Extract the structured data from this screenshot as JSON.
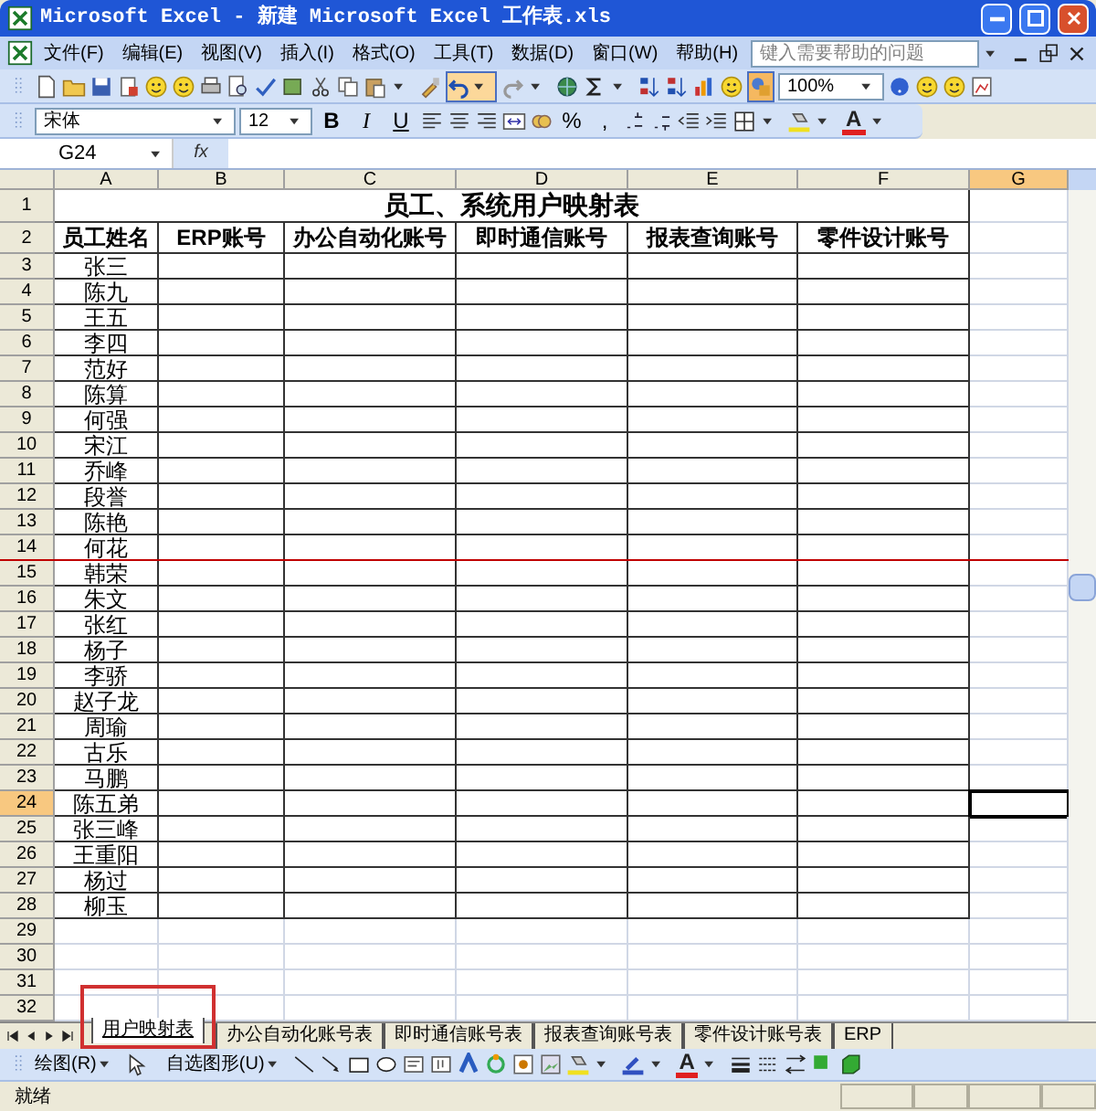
{
  "window": {
    "title": "Microsoft Excel - 新建 Microsoft Excel 工作表.xls"
  },
  "menu": [
    "文件(F)",
    "编辑(E)",
    "视图(V)",
    "插入(I)",
    "格式(O)",
    "工具(T)",
    "数据(D)",
    "窗口(W)",
    "帮助(H)"
  ],
  "help_box": {
    "placeholder": "键入需要帮助的问题"
  },
  "standard_toolbar": {
    "zoom": "100%"
  },
  "format_toolbar": {
    "font": "宋体",
    "size": "12",
    "style_buttons": [
      "B",
      "I",
      "U"
    ],
    "number_buttons": [
      "%",
      ","
    ],
    "font_color": "A"
  },
  "formula_bar": {
    "name_box": "G24",
    "fx": "fx"
  },
  "sheet": {
    "columns": [
      {
        "label": "A",
        "selected": false
      },
      {
        "label": "B",
        "selected": false
      },
      {
        "label": "C",
        "selected": false
      },
      {
        "label": "D",
        "selected": false
      },
      {
        "label": "E",
        "selected": false
      },
      {
        "label": "F",
        "selected": false
      },
      {
        "label": "G",
        "selected": true
      }
    ],
    "rows": [
      {
        "number": "1",
        "selected": false,
        "title": "员工、系统用户映射表"
      },
      {
        "number": "2",
        "selected": false,
        "cells": [
          "员工姓名",
          "ERP账号",
          "办公自动化账号",
          "即时通信账号",
          "报表查询账号",
          "零件设计账号"
        ]
      },
      {
        "number": "3",
        "selected": false,
        "cells": [
          "张三"
        ]
      },
      {
        "number": "4",
        "selected": false,
        "cells": [
          "陈九"
        ]
      },
      {
        "number": "5",
        "selected": false,
        "cells": [
          "王五"
        ]
      },
      {
        "number": "6",
        "selected": false,
        "cells": [
          "李四"
        ]
      },
      {
        "number": "7",
        "selected": false,
        "cells": [
          "范好"
        ]
      },
      {
        "number": "8",
        "selected": false,
        "cells": [
          "陈算"
        ]
      },
      {
        "number": "9",
        "selected": false,
        "cells": [
          "何强"
        ]
      },
      {
        "number": "10",
        "selected": false,
        "cells": [
          "宋江"
        ]
      },
      {
        "number": "11",
        "selected": false,
        "cells": [
          "乔峰"
        ]
      },
      {
        "number": "12",
        "selected": false,
        "cells": [
          "段誉"
        ]
      },
      {
        "number": "13",
        "selected": false,
        "cells": [
          "陈艳"
        ]
      },
      {
        "number": "14",
        "selected": false,
        "cells": [
          "何花"
        ]
      },
      {
        "number": "15",
        "selected": false,
        "cells": [
          "韩荣"
        ]
      },
      {
        "number": "16",
        "selected": false,
        "cells": [
          "朱文"
        ]
      },
      {
        "number": "17",
        "selected": false,
        "cells": [
          "张红"
        ]
      },
      {
        "number": "18",
        "selected": false,
        "cells": [
          "杨子"
        ]
      },
      {
        "number": "19",
        "selected": false,
        "cells": [
          "李骄"
        ]
      },
      {
        "number": "20",
        "selected": false,
        "cells": [
          "赵子龙"
        ]
      },
      {
        "number": "21",
        "selected": false,
        "cells": [
          "周瑜"
        ]
      },
      {
        "number": "22",
        "selected": false,
        "cells": [
          "古乐"
        ]
      },
      {
        "number": "23",
        "selected": false,
        "cells": [
          "马鹏"
        ]
      },
      {
        "number": "24",
        "selected": true,
        "cells": [
          "陈五弟"
        ]
      },
      {
        "number": "25",
        "selected": false,
        "cells": [
          "张三峰"
        ]
      },
      {
        "number": "26",
        "selected": false,
        "cells": [
          "王重阳"
        ]
      },
      {
        "number": "27",
        "selected": false,
        "cells": [
          "杨过"
        ]
      },
      {
        "number": "28",
        "selected": false,
        "cells": [
          "柳玉"
        ]
      },
      {
        "number": "29",
        "selected": false
      },
      {
        "number": "30",
        "selected": false
      },
      {
        "number": "31",
        "selected": false
      },
      {
        "number": "32",
        "selected": false
      }
    ]
  },
  "sheet_tabs": [
    {
      "label": "用户映射表",
      "selected": true
    },
    {
      "label": "办公自动化账号表",
      "selected": false
    },
    {
      "label": "即时通信账号表",
      "selected": false
    },
    {
      "label": "报表查询账号表",
      "selected": false
    },
    {
      "label": "零件设计账号表",
      "selected": false
    },
    {
      "label": "ERP",
      "selected": false
    }
  ],
  "drawing_toolbar": {
    "draw_menu": "绘图(R)",
    "autoshapes_menu": "自选图形(U)",
    "font_color": "A"
  },
  "status_bar": {
    "text": "就绪"
  }
}
